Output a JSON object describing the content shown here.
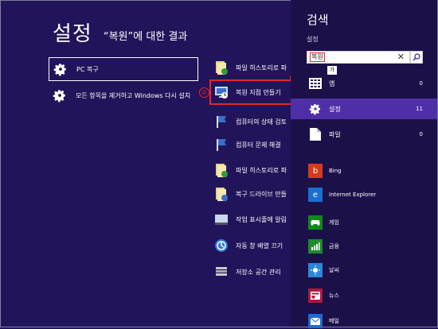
{
  "header": {
    "title": "설정",
    "query_note": "“복원”에 대한 결과"
  },
  "left_tiles": [
    {
      "label": "PC 복구"
    },
    {
      "label": "모든 항목을 제거하고 Windows 다시 설치"
    }
  ],
  "results": [
    {
      "label": "파일 히스토리로 파"
    },
    {
      "label": "복원 지점 만들기"
    },
    {
      "label": "컴퓨터의 상태 검토"
    },
    {
      "label": "컴퓨터 문제 해결"
    },
    {
      "label": "파일 히스토리로 파"
    },
    {
      "label": "복구 드라이브 만들"
    },
    {
      "label": "작업 표시줄에 알림"
    },
    {
      "label": "자동 창 배열 끄기"
    },
    {
      "label": "저장소 공간 관리"
    }
  ],
  "search_pane": {
    "title": "검색",
    "scope": "설정",
    "query": "복원",
    "ime_char": "가",
    "clear_glyph": "✕",
    "categories": [
      {
        "label": "앱",
        "count": "0"
      },
      {
        "label": "설정",
        "count": "11"
      },
      {
        "label": "파일",
        "count": "0"
      }
    ],
    "apps": [
      {
        "label": "Bing",
        "color": "#d63a1c"
      },
      {
        "label": "Internet Explorer",
        "color": "#1a6fd1"
      },
      {
        "label": "게임",
        "color": "#0f8a18"
      },
      {
        "label": "금융",
        "color": "#1e8a2c"
      },
      {
        "label": "날씨",
        "color": "#2b88d8"
      },
      {
        "label": "뉴스",
        "color": "#b4163a"
      },
      {
        "label": "메일",
        "color": "#1f6ad0"
      }
    ]
  },
  "markers": {
    "one": "①",
    "two": "②"
  },
  "colors": {
    "background": "#22145a",
    "pane": "#1b1048",
    "selected": "#4f2fa8",
    "annotation": "#e8242c"
  }
}
